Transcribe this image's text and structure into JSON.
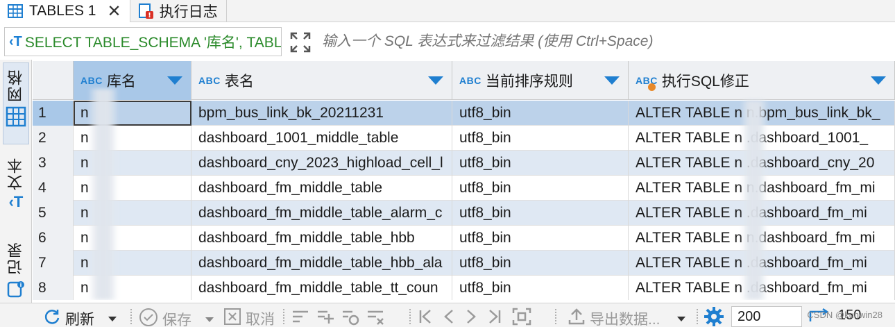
{
  "tabs": [
    {
      "label": "TABLES 1",
      "icon": "table-grid-icon",
      "active": true
    },
    {
      "label": "执行日志",
      "icon": "log-error-icon",
      "active": false
    }
  ],
  "filter": {
    "sql_text": "SELECT TABLE_SCHEMA '库名', TABL",
    "placeholder": "输入一个 SQL 表达式来过滤结果 (使用 Ctrl+Space)"
  },
  "side_tabs": [
    {
      "label": "网格",
      "icon": "grid-icon",
      "active": true
    },
    {
      "label": "文本",
      "icon": "text-icon",
      "active": false
    },
    {
      "label": "记录",
      "icon": "record-icon",
      "active": false
    }
  ],
  "columns": [
    {
      "type_badge": "ABC",
      "label": "库名"
    },
    {
      "type_badge": "ABC",
      "label": "表名"
    },
    {
      "type_badge": "ABC",
      "label": "当前排序规则"
    },
    {
      "type_badge": "ABC",
      "label": "执行SQL修正"
    }
  ],
  "rows": [
    {
      "n": "1",
      "schema": "n",
      "table": "bpm_bus_link_bk_20211231",
      "collation": "utf8_bin",
      "sql": "ALTER TABLE n     n.bpm_bus_link_bk_"
    },
    {
      "n": "2",
      "schema": "n",
      "table": "dashboard_1001_middle_table",
      "collation": "utf8_bin",
      "sql": "ALTER TABLE n     .dashboard_1001_"
    },
    {
      "n": "3",
      "schema": "n",
      "table": "dashboard_cny_2023_highload_cell_l",
      "collation": "utf8_bin",
      "sql": "ALTER TABLE n     .dashboard_cny_20"
    },
    {
      "n": "4",
      "schema": "n",
      "table": "dashboard_fm_middle_table",
      "collation": "utf8_bin",
      "sql": "ALTER TABLE n     n.dashboard_fm_mi"
    },
    {
      "n": "5",
      "schema": "n",
      "table": "dashboard_fm_middle_table_alarm_c",
      "collation": "utf8_bin",
      "sql": "ALTER TABLE n     .dashboard_fm_mi"
    },
    {
      "n": "6",
      "schema": "n",
      "table": "dashboard_fm_middle_table_hbb",
      "collation": "utf8_bin",
      "sql": "ALTER TABLE n     n.dashboard_fm_mi"
    },
    {
      "n": "7",
      "schema": "n",
      "table": "dashboard_fm_middle_table_hbb_ala",
      "collation": "utf8_bin",
      "sql": "ALTER TABLE n     .dashboard_fm_mi"
    },
    {
      "n": "8",
      "schema": "n",
      "table": "dashboard_fm_middle_table_tt_coun",
      "collation": "utf8_bin",
      "sql": "ALTER TABLE n     .dashboard_fm_mi"
    }
  ],
  "toolbar": {
    "refresh": "刷新",
    "save": "保存",
    "cancel": "取消",
    "export": "导出数据...",
    "fetch_size": "200",
    "row_count": "150"
  },
  "watermark": "CSDN @kunwin28"
}
